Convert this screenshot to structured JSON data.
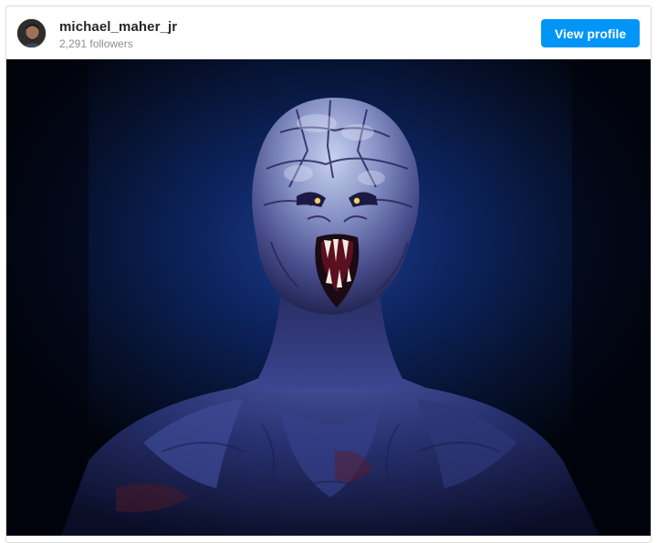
{
  "post": {
    "username": "michael_maher_jr",
    "followers": "2,291 followers",
    "view_profile_label": "View profile"
  },
  "icons": {
    "avatar": "profile-photo"
  },
  "colors": {
    "accent": "#0095f6",
    "username": "#262626",
    "secondary_text": "#8e8e8e",
    "border": "#dbdbdb"
  }
}
